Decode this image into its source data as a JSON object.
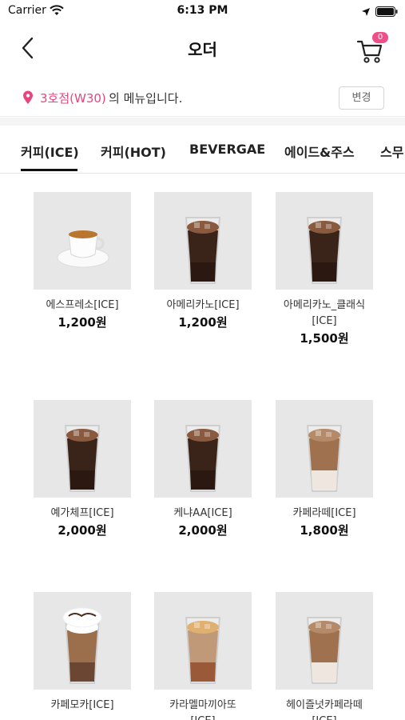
{
  "status": {
    "carrier": "Carrier",
    "time": "6:13 PM"
  },
  "nav": {
    "title": "오더",
    "cart_count": "0"
  },
  "store": {
    "name": "3호점(W30)",
    "suffix": "의 메뉴입니다.",
    "change_label": "변경"
  },
  "tabs": [
    {
      "label": "커피(ICE)",
      "active": true
    },
    {
      "label": "커피(HOT)",
      "active": false
    },
    {
      "label": "BEVERGAE",
      "active": false
    },
    {
      "label": "에이드&주스",
      "active": false
    },
    {
      "label": "스무",
      "active": false
    }
  ],
  "menu": [
    {
      "name": "에스프레소[ICE]",
      "price": "1,200원",
      "image": "espresso-cup"
    },
    {
      "name": "아메리카노[ICE]",
      "price": "1,200원",
      "image": "iced-americano"
    },
    {
      "name": "아메리카노_클래식\n[ICE]",
      "price": "1,500원",
      "image": "iced-americano"
    },
    {
      "name": "예가체프[ICE]",
      "price": "2,000원",
      "image": "iced-americano"
    },
    {
      "name": "케냐AA[ICE]",
      "price": "2,000원",
      "image": "iced-americano"
    },
    {
      "name": "카페라떼[ICE]",
      "price": "1,800원",
      "image": "iced-latte"
    },
    {
      "name": "카페모카[ICE]",
      "price": "",
      "image": "iced-mocha"
    },
    {
      "name": "카라멜마끼아또\n[ICE]",
      "price": "",
      "image": "caramel-macchiato"
    },
    {
      "name": "헤이즐넛카페라떼\n[ICE]",
      "price": "",
      "image": "iced-latte"
    }
  ],
  "colors": {
    "accent": "#e8457f",
    "badge": "#f04e8a"
  }
}
